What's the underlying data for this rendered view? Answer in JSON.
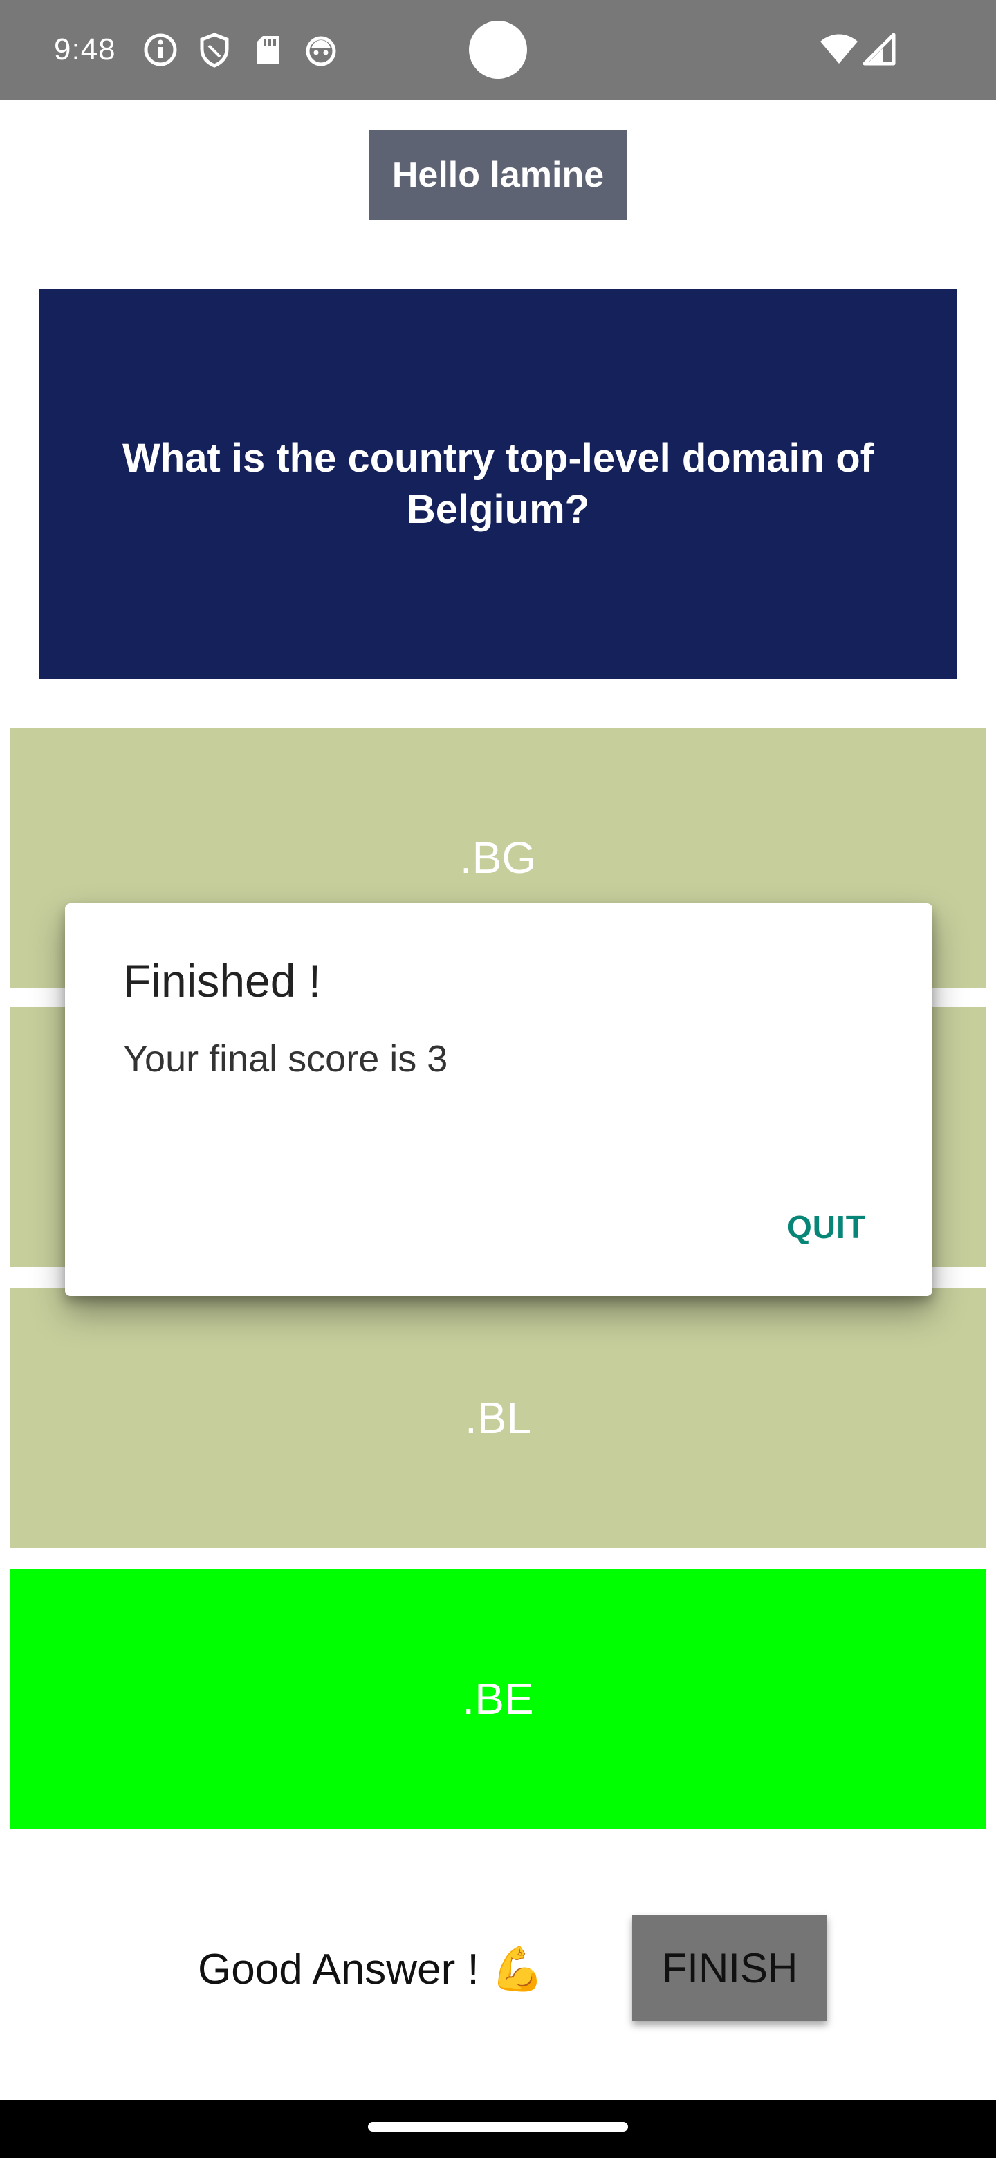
{
  "status_bar": {
    "time": "9:48",
    "icons": [
      "info-icon",
      "shield-icon",
      "sd-card-icon",
      "android-debug-icon",
      "wifi-icon",
      "signal-icon"
    ]
  },
  "greeting": "Hello lamine",
  "question": "What is the country top-level domain of Belgium?",
  "answers": [
    {
      "label": ".BG",
      "state": "default"
    },
    {
      "label": "",
      "state": "default"
    },
    {
      "label": ".BL",
      "state": "default"
    },
    {
      "label": ".BE",
      "state": "correct"
    }
  ],
  "feedback": "Good Answer ! 💪",
  "finish_label": "FINISH",
  "dialog": {
    "title": "Finished !",
    "message": "Your final score is 3",
    "quit_label": "QUIT"
  },
  "colors": {
    "status_bar": "#787878",
    "greeting_bg": "#5e6373",
    "question_bg": "#14215a",
    "answer_bg": "#c6ce9c",
    "answer_correct_bg": "#00ff00",
    "finish_bg": "#757575",
    "dialog_accent": "#078577"
  }
}
